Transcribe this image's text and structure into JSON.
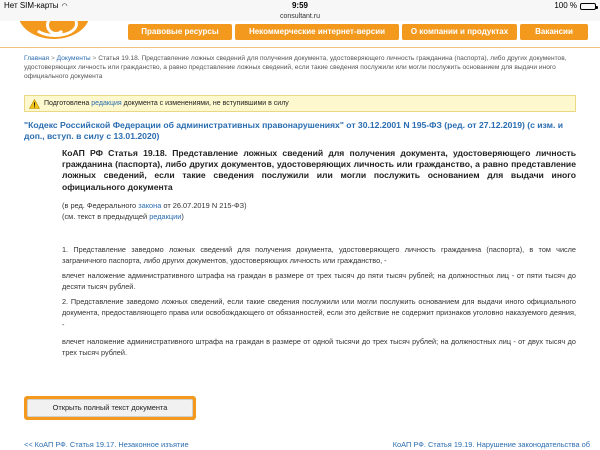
{
  "status_bar": {
    "carrier": "Нет SIM-карты",
    "time": "9:59",
    "battery": "100 %",
    "battery_level": 1.0
  },
  "browser": {
    "address": "consultant.ru"
  },
  "nav": {
    "items": [
      {
        "label": "Правовые ресурсы"
      },
      {
        "label": "Некоммерческие интернет-версии"
      },
      {
        "label": "О компании и продуктах"
      },
      {
        "label": "Вакансии"
      }
    ]
  },
  "breadcrumb": {
    "home": "Главная",
    "sep": ">",
    "documents": "Документы",
    "current": "Статья 19.18. Представление ложных сведений для получения документа, удостоверяющего личность гражданина (паспорта), либо других документов, удостоверяющих личность или гражданство, а равно представление ложных сведений, если такие сведения послужили или могли послужить основанием для выдачи иного официального документа"
  },
  "notice": {
    "before": "Подготовлена",
    "link": "редакция",
    "after": "документа с изменениями, не вступившими в силу"
  },
  "document": {
    "title": "\"Кодекс Российской Федерации об административных правонарушениях\" от 30.12.2001 N 195-ФЗ (ред. от 27.12.2019) (с изм. и доп., вступ. в силу с 13.01.2020)"
  },
  "article": {
    "heading": "КоАП РФ Статья 19.18. Представление ложных сведений для получения документа, удостоверяющего личность гражданина (паспорта), либо других документов, удостоверяющих личность или гражданство, а равно представление ложных сведений, если такие сведения послужили или могли послужить основанием для выдачи иного официального документа",
    "edition_before": "(в ред. Федерального",
    "edition_link": "закона",
    "edition_after": "от 26.07.2019 N 215-ФЗ)",
    "prev_text_before": "(см. текст в предыдущей",
    "prev_text_link": "редакции",
    "prev_text_after": ")",
    "p1": "1. Представление заведомо ложных сведений для получения документа, удостоверяющего личность гражданина (паспорта), в том числе заграничного паспорта, либо других документов, удостоверяющих личность или гражданство, -",
    "p1_penalty": "влечет наложение административного штрафа на граждан в размере от трех тысяч до пяти тысяч рублей; на должностных лиц - от пяти тысяч до десяти тысяч рублей.",
    "p2": "2. Представление заведомо ложных сведений, если такие сведения послужили или могли послужить основанием для выдачи иного официального документа, предоставляющего права или освобождающего от обязанностей, если это действие не содержит признаков уголовно наказуемого деяния, -",
    "p2_penalty": "влечет наложение административного штрафа на граждан в размере от одной тысячи до трех тысяч рублей; на должностных лиц - от двух тысяч до трех тысяч рублей."
  },
  "buttons": {
    "full_text": "Открыть полный текст документа"
  },
  "bottom_nav": {
    "prev": "<< КоАП РФ. Статья 19.17. Незаконное изъятие",
    "next": "КоАП РФ. Статья 19.19. Нарушение законодательства об"
  },
  "colors": {
    "accent": "#f39a1e",
    "link": "#2a6db0",
    "notice_bg": "#fdf8cd"
  }
}
